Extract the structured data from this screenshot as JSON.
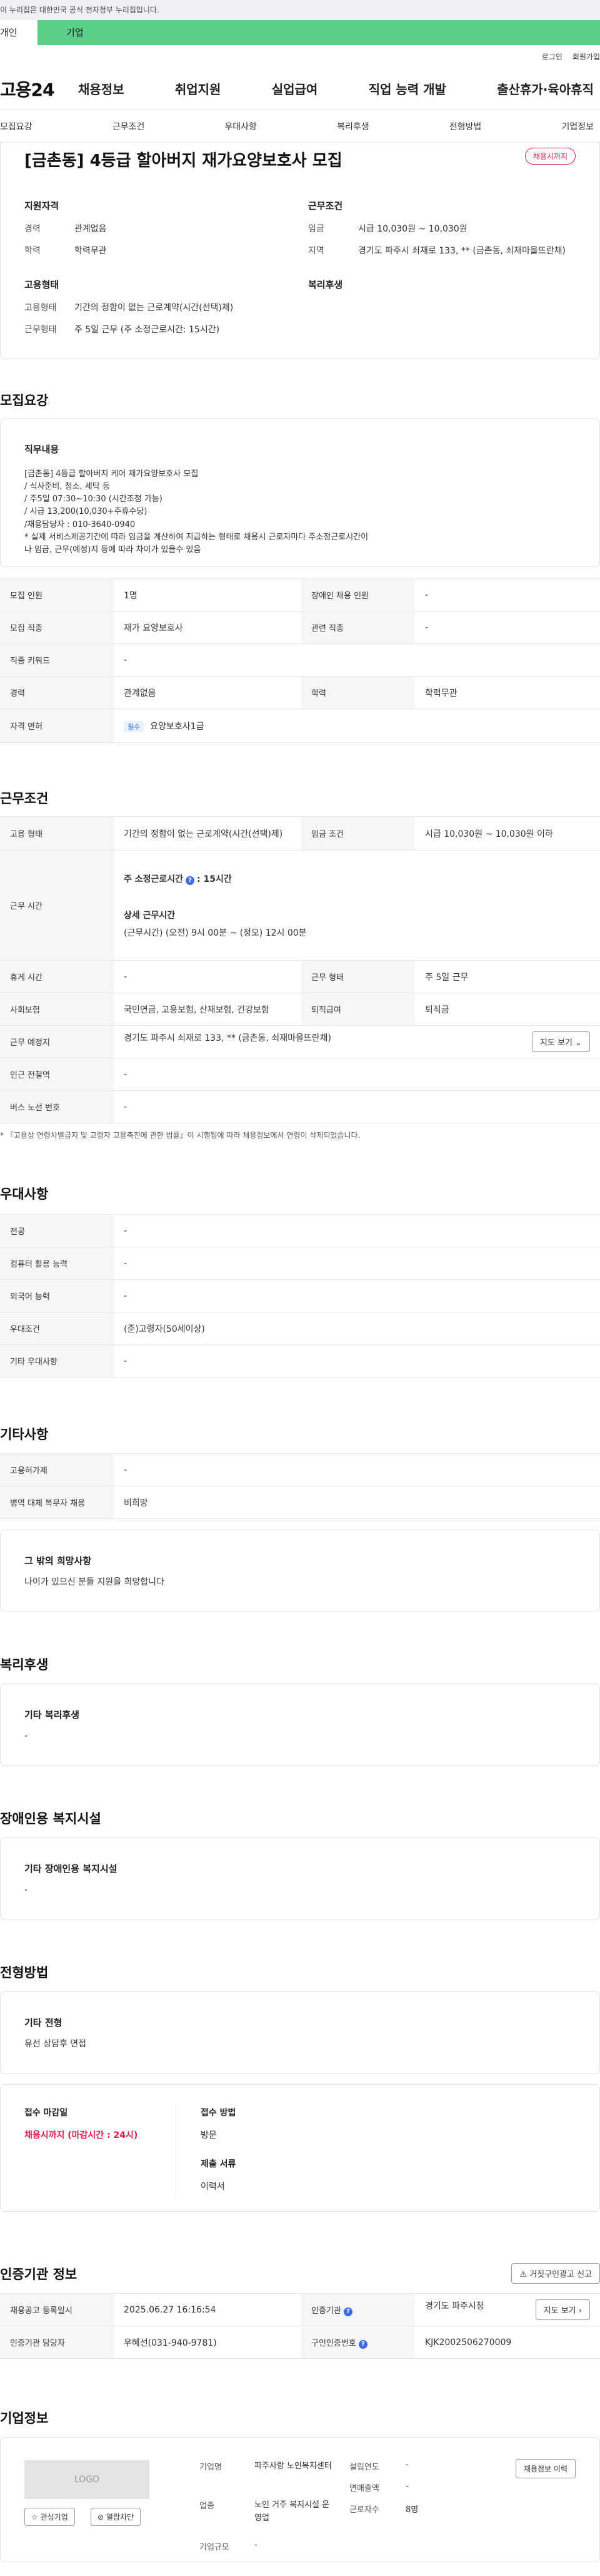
{
  "gov_banner": "이 누리집은 대한민국 공식 전자정부 누리집입니다.",
  "persona": {
    "person": "개인",
    "company": "기업"
  },
  "util": {
    "login": "로그인",
    "signup": "회원가입"
  },
  "header": {
    "logo": "고용24",
    "menu": [
      "채용정보",
      "취업지원",
      "실업급여",
      "직업 능력 개발",
      "출산휴가·육아휴직"
    ]
  },
  "subtabs": [
    "모집요강",
    "근무조건",
    "우대사항",
    "복리후생",
    "전형방법",
    "기업정보"
  ],
  "job": {
    "title": "[금촌동] 4등급 할아버지 재가요양보호사 모집",
    "status": "채용시까지",
    "qualification": {
      "heading": "지원자격",
      "rows": [
        {
          "k": "경력",
          "v": "관계없음"
        },
        {
          "k": "학력",
          "v": "학력무관"
        }
      ]
    },
    "conditions": {
      "heading": "근무조건",
      "rows": [
        {
          "k": "임금",
          "v": "시급 10,030원 ~ 10,030원"
        },
        {
          "k": "지역",
          "v": "경기도 파주시 쇠재로 133, ** (금촌동, 쇠재마을뜨란채)"
        }
      ]
    },
    "employment": {
      "heading": "고용형태",
      "rows": [
        {
          "k": "고용형태",
          "v": "기간의 정함이 없는 근로계약(시간(선택)제)"
        },
        {
          "k": "근무형태",
          "v": "주 5일 근무 (주 소정근로시간: 15시간)"
        }
      ]
    },
    "welfare_heading": "복리후생"
  },
  "recruit": {
    "title": "모집요강",
    "duty_head": "직무내용",
    "duty_body": "[금촌동] 4등급 할아버지 케어 재가요양보호사 모집\n/ 식사준비, 청소, 세탁 등\n/ 주5일 07:30~10:30 (시간조정 가능)\n/ 시급 13,200(10,030+주휴수당)\n/채용담당자 : 010-3640-0940\n* 실제 서비스제공기간에 따라 임금을 계산하여 지급하는 형태로 채용시 근로자마다 주소정근로시간이\n나 임금, 근무(예정)지 등에 따라 차이가 있을수 있음",
    "rows": [
      {
        "k1": "모집 인원",
        "v1": "1명",
        "k2": "장애인 채용 인원",
        "v2": "-"
      },
      {
        "k1": "모집 직종",
        "v1": "재가 요양보호사",
        "k2": "관련 직종",
        "v2": "-"
      },
      {
        "k1": "직종 키워드",
        "v1": "-"
      },
      {
        "k1": "경력",
        "v1": "관계없음",
        "k2": "학력",
        "v2": "학력무관"
      }
    ],
    "license_k": "자격 면허",
    "license_tag": "필수",
    "license_v": "요양보호사1급"
  },
  "work": {
    "title": "근무조건",
    "emp_type_k": "고용 형태",
    "emp_type_v": "기간의 정함이 없는 근로계약(시간(선택)제)",
    "wage_k": "임금 조건",
    "wage_v": "시급 10,030원 ~ 10,030원 이하",
    "hours_k": "근무 시간",
    "hours_sub1": "주 소정근로시간",
    "hours_sub1_val": ": 15시간",
    "hours_sub2": "상세 근무시간",
    "hours_detail": "(근무시간) (오전) 9시 00분 ~ (정오) 12시 00분",
    "break_k": "휴게 시간",
    "break_v": "-",
    "shift_k": "근무 형태",
    "shift_v": "주 5일 근무",
    "insurance_k": "사회보험",
    "insurance_v": "국민연금, 고용보험, 산재보험, 건강보험",
    "severance_k": "퇴직급여",
    "severance_v": "퇴직금",
    "place_k": "근무 예정지",
    "place_v": "경기도 파주시 쇠재로 133, ** (금촌동, 쇠재마을뜨란채)",
    "map_btn": "지도 보기",
    "station_k": "인근 전철역",
    "station_v": "-",
    "bus_k": "버스 노선 번호",
    "bus_v": "-",
    "note": "* 『고용상 연령차별금지 및 고령자 고용촉진에 관한 법률』이 시행됨에 따라 채용정보에서 연령이 삭제되었습니다."
  },
  "prefer": {
    "title": "우대사항",
    "rows": [
      {
        "k": "전공",
        "v": "-"
      },
      {
        "k": "컴퓨터 활용 능력",
        "v": "-"
      },
      {
        "k": "외국어 능력",
        "v": "-"
      },
      {
        "k": "우대조건",
        "v": "(준)고령자(50세이상)"
      },
      {
        "k": "기타 우대사항",
        "v": "-"
      }
    ]
  },
  "etc": {
    "title": "기타사항",
    "rows": [
      {
        "k": "고용허가제",
        "v": "-"
      },
      {
        "k": "병역 대체 복무자 채용",
        "v": "비희망"
      }
    ],
    "hope_head": "그 밖의 희망사항",
    "hope_body": "나이가 있으신 분들 지원을 희망합니다"
  },
  "welfare": {
    "title": "복리후생",
    "head": "기타 복리후생",
    "body": "-"
  },
  "disability": {
    "title": "장애인용 복지시설",
    "head": "기타 장애인용 복지시설",
    "body": "-"
  },
  "selection": {
    "title": "전형방법",
    "head": "기타 전형",
    "body": "유선 상담후 면접",
    "deadline_head": "접수 마감일",
    "deadline_val": "채용시까지 (마감시간 : 24시)",
    "method_head": "접수 방법",
    "method_val": "방문",
    "docs_head": "제출 서류",
    "docs_val": "이력서"
  },
  "cert": {
    "title": "인증기관 정보",
    "report_btn": "거짓구인광고 신고",
    "reg_k": "채용공고 등록일시",
    "reg_v": "2025.06.27 16:16:54",
    "org_k": "인증기관",
    "org_v": "경기도 파주시청",
    "map_btn": "지도 보기",
    "mgr_k": "인증기관 담당자",
    "mgr_v": "우혜선(031-940-9781)",
    "num_k": "구인인증번호",
    "num_v": "KJK2002506270009"
  },
  "company": {
    "title": "기업정보",
    "logo_text": "LOGO",
    "fav_btn": "관심기업",
    "block_btn": "열람차단",
    "name_k": "기업명",
    "name_v": "파주사랑 노인복지센터",
    "year_k": "설립연도",
    "year_v": "-",
    "industry_k": "업종",
    "industry_v": "노인 거주 복지시설 운영업",
    "sales_k": "연매출액",
    "sales_v": "-",
    "emp_k": "근로자수",
    "emp_v": "8명",
    "size_k": "기업규모",
    "size_v": "-",
    "more_btn": "채용정보 이력"
  }
}
